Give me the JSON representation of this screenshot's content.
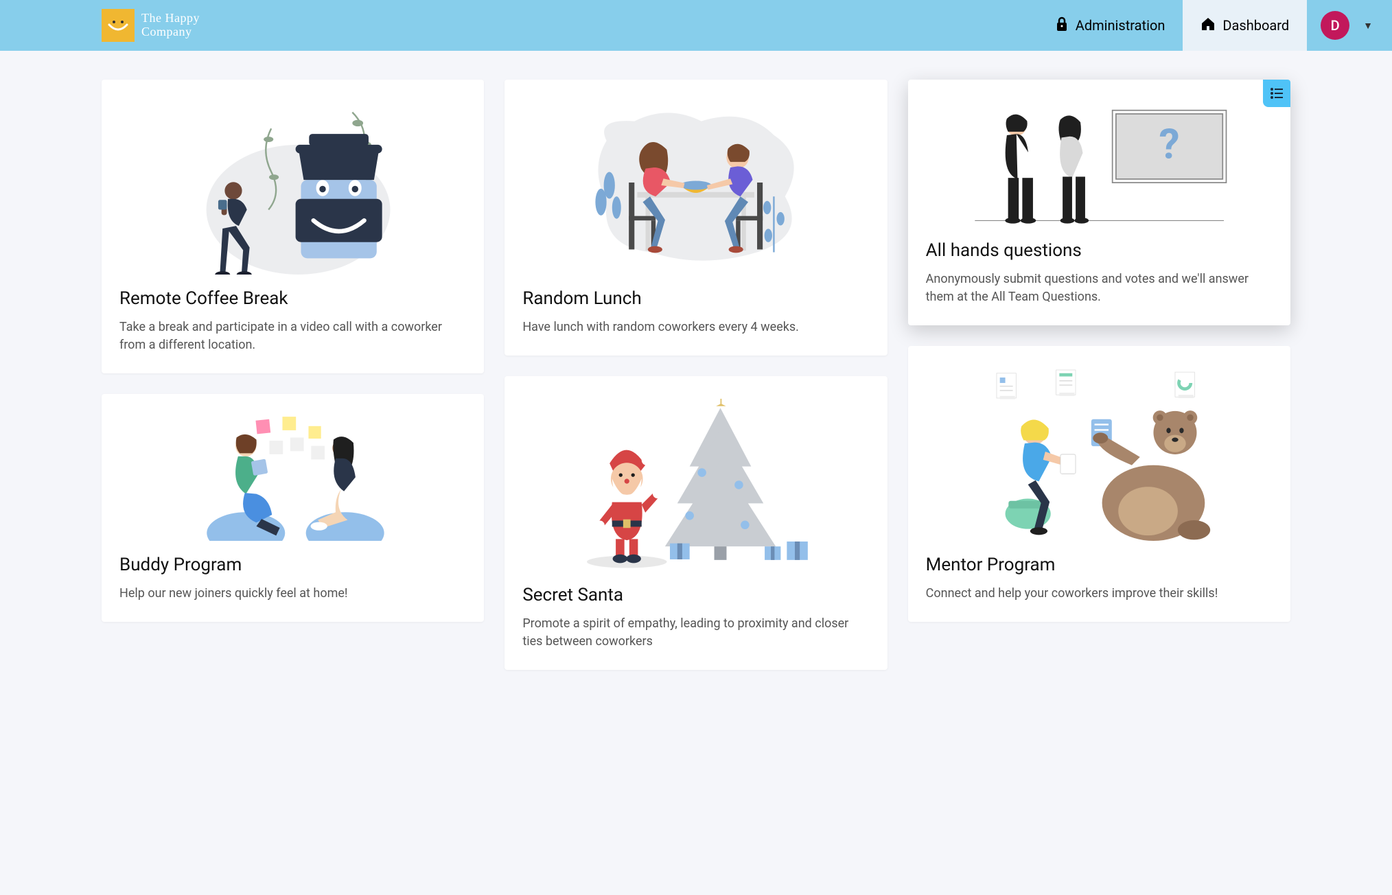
{
  "brand": {
    "line1": "The Happy",
    "line2": "Company"
  },
  "nav": {
    "administration": "Administration",
    "dashboard": "Dashboard"
  },
  "avatar": {
    "initial": "D"
  },
  "cards": {
    "coffee": {
      "title": "Remote Coffee Break",
      "desc": "Take a break and participate in a video call with a coworker from a different location."
    },
    "buddy": {
      "title": "Buddy Program",
      "desc": "Help our new joiners quickly feel at home!"
    },
    "lunch": {
      "title": "Random Lunch",
      "desc": "Have lunch with random coworkers every 4 weeks."
    },
    "santa": {
      "title": "Secret Santa",
      "desc": "Promote a spirit of empathy, leading to proximity and closer ties between coworkers"
    },
    "questions": {
      "title": "All hands questions",
      "desc": "Anonymously submit questions and votes and we'll answer them at the All Team Questions."
    },
    "mentor": {
      "title": "Mentor Program",
      "desc": "Connect and help your coworkers improve their skills!"
    }
  }
}
